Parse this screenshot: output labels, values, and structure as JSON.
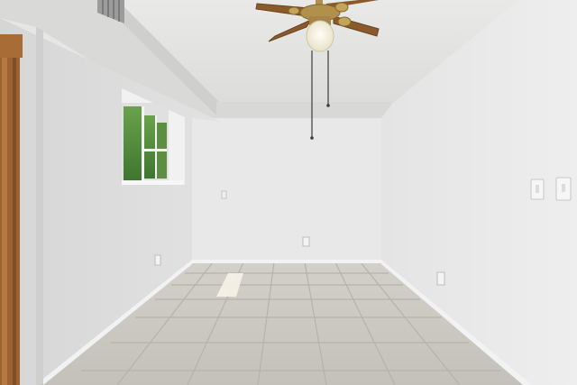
{
  "scene": {
    "kind": "photo",
    "subject": "empty room",
    "colors": {
      "ceiling": "#e3e3e1",
      "wall_left": "#dfdfdf",
      "wall_back": "#e8e8e8",
      "wall_right": "#ececec",
      "floor_tile": "#c9c6bf",
      "grout": "#b3b0a8",
      "baseboard": "#f4f4f4",
      "door_trim": "#a36a33",
      "fan_blade": "#8a5a2a",
      "fan_brass": "#b0904a",
      "window_greenery": "#4f8a3a"
    }
  }
}
